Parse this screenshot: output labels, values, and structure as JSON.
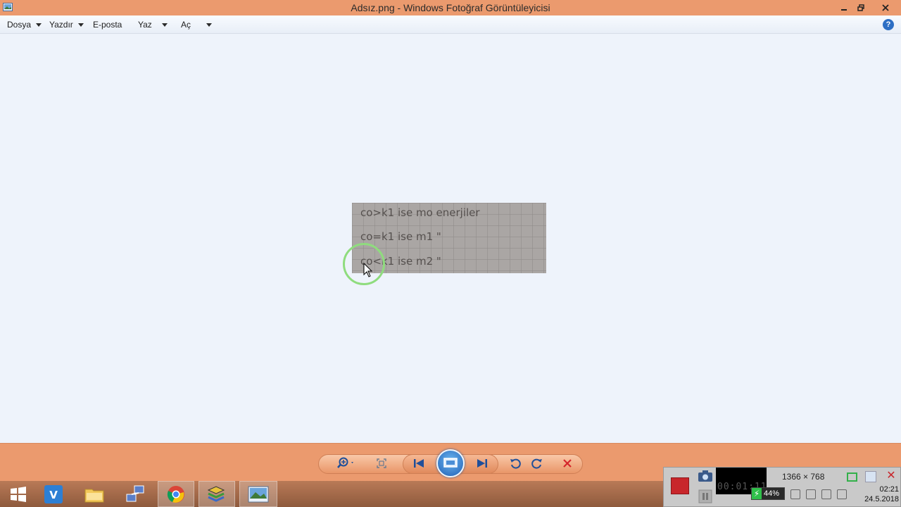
{
  "window": {
    "title": "Adsız.png - Windows Fotoğraf Görüntüleyicisi"
  },
  "menu": {
    "items": [
      {
        "label": "Dosya",
        "has_arrow": true
      },
      {
        "label": "Yazdır",
        "has_arrow": true
      },
      {
        "label": "E-posta",
        "has_arrow": false
      },
      {
        "label": "Yaz",
        "has_arrow": true
      },
      {
        "label": "Aç",
        "has_arrow": true
      }
    ],
    "help_label": "?"
  },
  "photo": {
    "lines": [
      "co>k1  ise  mo  enerjiler",
      "co=k1  ise  m1     \"",
      "co<k1  ise  m2     \""
    ]
  },
  "controls": {
    "icons": [
      "zoom-icon",
      "actual-size-icon",
      "previous-icon",
      "slideshow-icon",
      "next-icon",
      "rotate-left-icon",
      "rotate-right-icon",
      "delete-icon"
    ]
  },
  "taskbar": {
    "items": [
      "start-icon",
      "vc-app-icon",
      "file-explorer-icon",
      "network-app-icon",
      "chrome-icon",
      "layers-app-icon",
      "photo-viewer-icon"
    ]
  },
  "recorder": {
    "resolution": "1366 × 768",
    "timer": "00:01:11",
    "battery": "44%"
  },
  "clock": {
    "time": "02:21",
    "date": "24.5.2018"
  },
  "colors": {
    "accent": "#eb9a6e",
    "background": "#eef3fb",
    "record": "#c8262b"
  }
}
